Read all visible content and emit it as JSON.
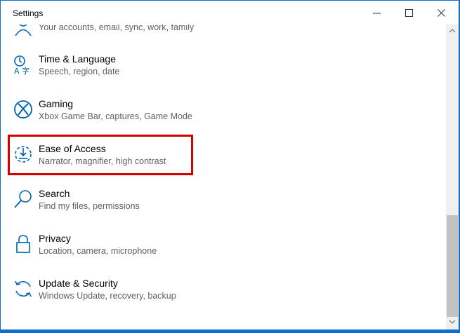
{
  "window": {
    "title": "Settings",
    "controls": [
      "minimize",
      "maximize",
      "close"
    ]
  },
  "items": [
    {
      "label": "",
      "desc": "Your accounts, email, sync, work, family",
      "icon": "accounts-icon"
    },
    {
      "label": "Time & Language",
      "desc": "Speech, region, date",
      "icon": "time-language-icon"
    },
    {
      "label": "Gaming",
      "desc": "Xbox Game Bar, captures, Game Mode",
      "icon": "xbox-icon"
    },
    {
      "label": "Ease of Access",
      "desc": "Narrator, magnifier, high contrast",
      "icon": "ease-of-access-icon"
    },
    {
      "label": "Search",
      "desc": "Find my files, permissions",
      "icon": "search-icon"
    },
    {
      "label": "Privacy",
      "desc": "Location, camera, microphone",
      "icon": "lock-icon"
    },
    {
      "label": "Update & Security",
      "desc": "Windows Update, recovery, backup",
      "icon": "sync-icon"
    }
  ],
  "colors": {
    "accent": "#0063b1",
    "highlight": "#d40000",
    "desktop": "#0f6fcf"
  }
}
